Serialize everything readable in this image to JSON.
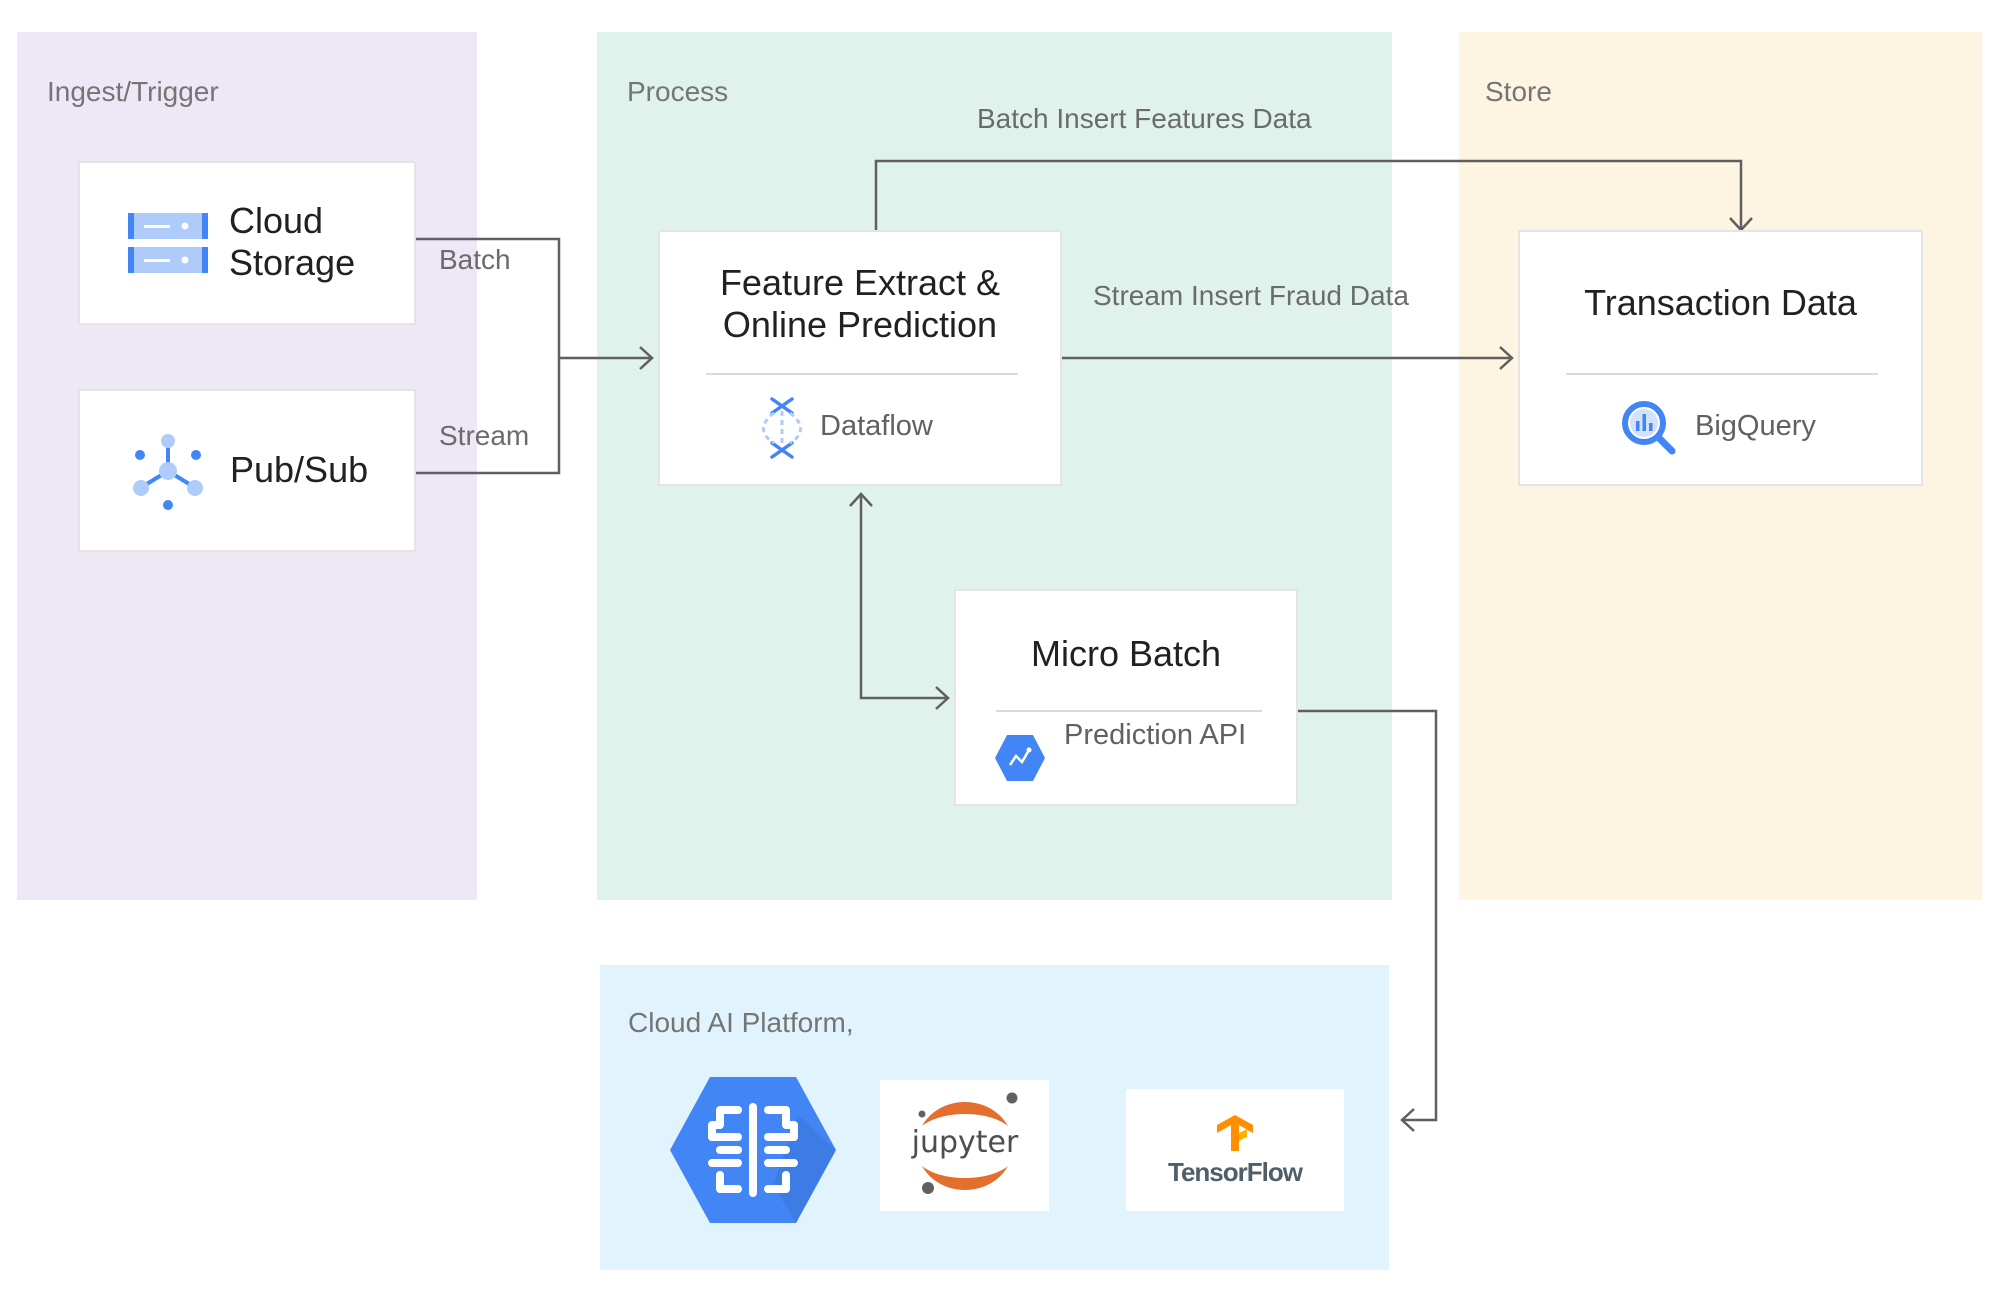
{
  "panels": {
    "ingest": {
      "title": "Ingest/Trigger",
      "color": "#ede7f6"
    },
    "process": {
      "title": "Process",
      "color": "#e0f2ec"
    },
    "store": {
      "title": "Store",
      "color": "#fdf5e1"
    },
    "ai_platform": {
      "title": "Cloud AI Platform,",
      "color": "#e1f4fd"
    }
  },
  "nodes": {
    "cloud_storage": {
      "line1": "Cloud",
      "line2": "Storage",
      "icon": "cloud-storage-icon"
    },
    "pubsub": {
      "label": "Pub/Sub",
      "icon": "pubsub-icon"
    },
    "feature_extract": {
      "line1": "Feature Extract &",
      "line2": "Online Prediction",
      "service": "Dataflow",
      "icon": "dataflow-icon"
    },
    "transaction_data": {
      "title": "Transaction Data",
      "service": "BigQuery",
      "icon": "bigquery-icon"
    },
    "micro_batch": {
      "title": "Micro Batch",
      "service": "Prediction API",
      "icon": "prediction-api-icon"
    },
    "ai_logos": {
      "ai_platform_icon": "ai-platform-brain-icon",
      "jupyter": "jupyter",
      "tensorflow": "TensorFlow"
    }
  },
  "edges": {
    "batch": "Batch",
    "stream": "Stream",
    "batch_insert": "Batch Insert Features Data",
    "stream_insert": "Stream Insert Fraud Data"
  },
  "colors": {
    "google_blue": "#4285f4",
    "light_blue": "#aecbfa",
    "jupyter_orange": "#e46e2e",
    "tensorflow_orange": "#ff8f00",
    "wire": "#5f5f5f"
  }
}
